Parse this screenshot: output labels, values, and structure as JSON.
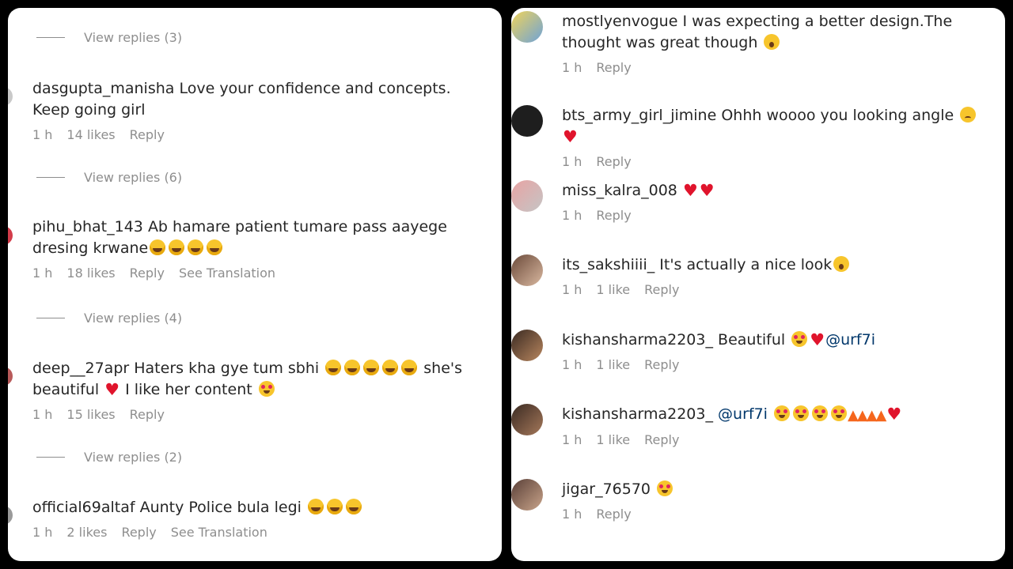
{
  "left": {
    "view_replies": [
      "View replies (3)",
      "View replies (6)",
      "View replies (4)",
      "View replies (2)"
    ],
    "comments": [
      {
        "user": "dasgupta_manisha",
        "text": "Love your confidence and concepts. Keep going girl",
        "time": "1 h",
        "likes": "14 likes",
        "reply": "Reply"
      },
      {
        "user": "pihu_bhat_143",
        "text": "Ab hamare patient tumare pass aayege dresing krwane",
        "time": "1 h",
        "likes": "18 likes",
        "reply": "Reply",
        "translation": "See Translation"
      },
      {
        "user": "deep__27apr",
        "text": "Haters kha gye tum sbhi",
        "text2": "she's beautiful",
        "text3": "I like her content",
        "time": "1 h",
        "likes": "15 likes",
        "reply": "Reply"
      },
      {
        "user": "official69altaf",
        "text": "Aunty Police bula legi",
        "time": "1 h",
        "likes": "2 likes",
        "reply": "Reply",
        "translation": "See Translation"
      }
    ]
  },
  "right": {
    "comments": [
      {
        "user": "mostlyenvogue",
        "text": "I was expecting a better design.The thought was great though",
        "time": "1 h",
        "reply": "Reply"
      },
      {
        "user": "bts_army_girl_jimine",
        "text": "Ohhh woooo you looking angle",
        "time": "1 h",
        "reply": "Reply"
      },
      {
        "user": "miss_kalra_008",
        "text": "",
        "time": "1 h",
        "reply": "Reply"
      },
      {
        "user": "its_sakshiiii_",
        "text": "It's actually a nice look",
        "time": "1 h",
        "likes": "1 like",
        "reply": "Reply"
      },
      {
        "user": "kishansharma2203_",
        "text": "Beautiful",
        "mention": "@urf7i",
        "time": "1 h",
        "likes": "1 like",
        "reply": "Reply"
      },
      {
        "user": "kishansharma2203_",
        "mention": "@urf7i",
        "time": "1 h",
        "likes": "1 like",
        "reply": "Reply"
      },
      {
        "user": "jigar_76570",
        "text": "",
        "time": "1 h",
        "reply": "Reply"
      }
    ]
  },
  "colors": {
    "background": "#000000",
    "panel": "#ffffff",
    "text": "#262626",
    "muted": "#8e8e8e",
    "mention": "#00376b",
    "heart": "#e0142c"
  }
}
